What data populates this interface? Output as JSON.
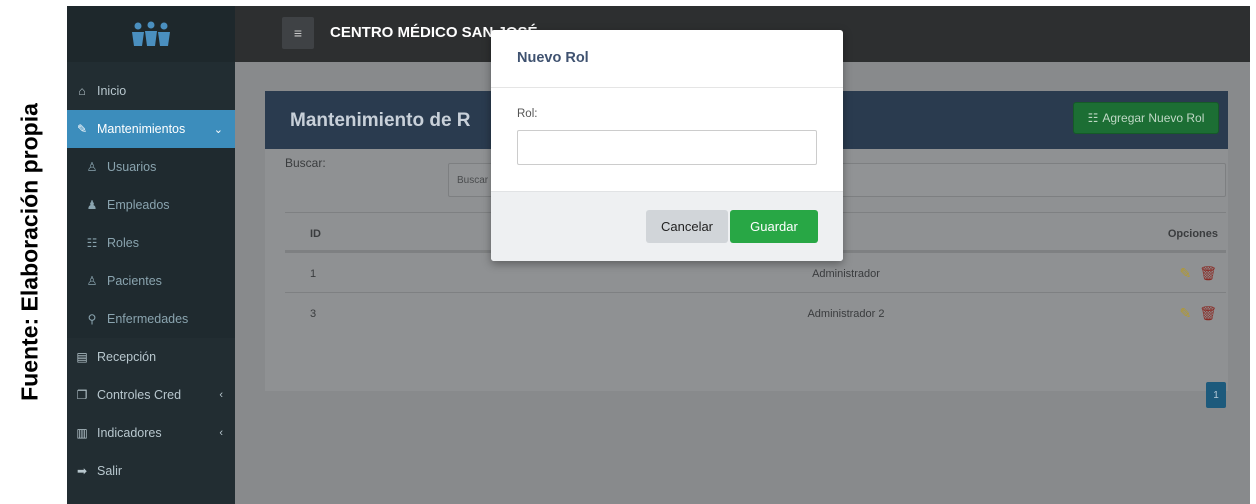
{
  "caption": "Fuente: Elaboración propia",
  "app": {
    "title": "CENTRO MÉDICO SAN JOSÉ"
  },
  "sidebar": {
    "items": [
      {
        "label": "Inicio",
        "icon": "home-icon"
      },
      {
        "label": "Mantenimientos",
        "icon": "wrench-icon",
        "active": true
      },
      {
        "label": "Usuarios",
        "icon": "user-icon"
      },
      {
        "label": "Empleados",
        "icon": "employees-icon"
      },
      {
        "label": "Roles",
        "icon": "roles-icon"
      },
      {
        "label": "Pacientes",
        "icon": "user-icon"
      },
      {
        "label": "Enfermedades",
        "icon": "search-icon"
      },
      {
        "label": "Recepción",
        "icon": "clipboard-icon"
      },
      {
        "label": "Controles Cred",
        "icon": "copy-icon"
      },
      {
        "label": "Indicadores",
        "icon": "bar-chart-icon"
      },
      {
        "label": "Salir",
        "icon": "exit-icon"
      }
    ]
  },
  "page": {
    "title": "Mantenimiento de R",
    "add_button": "Agregar Nuevo Rol",
    "search_label": "Buscar:",
    "search_placeholder": "Buscar",
    "table": {
      "headers": [
        "ID",
        "Opciones"
      ],
      "rows": [
        {
          "id": "1",
          "role": "Administrador"
        },
        {
          "id": "3",
          "role": "Administrador 2"
        }
      ]
    },
    "pagination_current": "1"
  },
  "modal": {
    "title": "Nuevo Rol",
    "field_label": "Rol:",
    "field_value": "",
    "cancel_label": "Cancelar",
    "save_label": "Guardar"
  },
  "colors": {
    "sidebar_bg": "#222d32",
    "active_item": "#3c8dbc",
    "topbar_bg": "#2d2f30",
    "header_bar": "#2a3b4f",
    "save_button": "#28a745",
    "add_button": "#1c6e34"
  }
}
